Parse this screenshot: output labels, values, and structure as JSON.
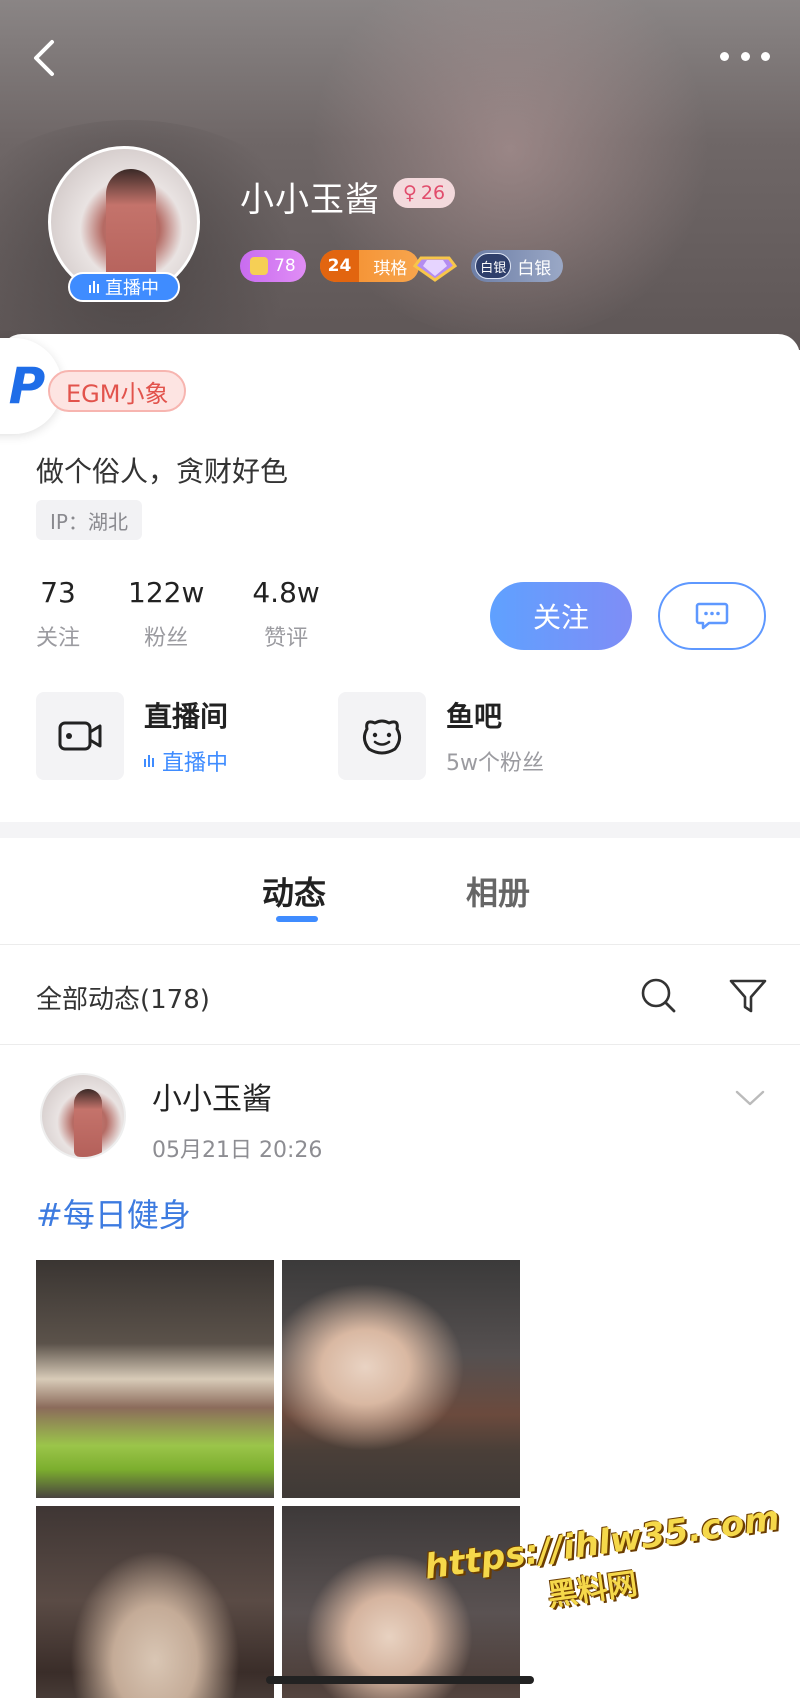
{
  "header": {
    "back_icon": "chevron-left-icon",
    "more_icon": "more-dots-icon"
  },
  "profile": {
    "username": "小小玉酱",
    "gender_level": "26",
    "live_badge": "直播中",
    "badges": {
      "user_level": "78",
      "fan_level": "24",
      "fan_name": "琪格",
      "rank": "白银",
      "rank_emblem": "白银"
    },
    "tag": "EGM小象",
    "bio": "做个俗人，贪财好色",
    "ip": "IP：湖北"
  },
  "stats": [
    {
      "value": "73",
      "label": "关注"
    },
    {
      "value": "122w",
      "label": "粉丝"
    },
    {
      "value": "4.8w",
      "label": "赞评"
    }
  ],
  "actions": {
    "follow_label": "关注",
    "message_icon": "chat-bubble-icon"
  },
  "entries": [
    {
      "title": "直播间",
      "subtitle": "直播中",
      "icon": "video-camera-icon"
    },
    {
      "title": "鱼吧",
      "subtitle": "5w个粉丝",
      "icon": "fish-bar-icon"
    }
  ],
  "tabs": [
    {
      "label": "动态",
      "active": true
    },
    {
      "label": "相册",
      "active": false
    }
  ],
  "filter": {
    "label": "全部动态(178)"
  },
  "post": {
    "author": "小小玉酱",
    "time": "05月21日 20:26",
    "hashtag": "#每日健身"
  },
  "watermark": {
    "url": "https://ihlw35.com",
    "name": "黑料网"
  },
  "colors": {
    "accent": "#3f8cff",
    "follow_gradient_start": "#5fa1ff",
    "follow_gradient_end": "#7f8df6",
    "tag_text": "#e2534c",
    "hashtag": "#3d7be0"
  }
}
